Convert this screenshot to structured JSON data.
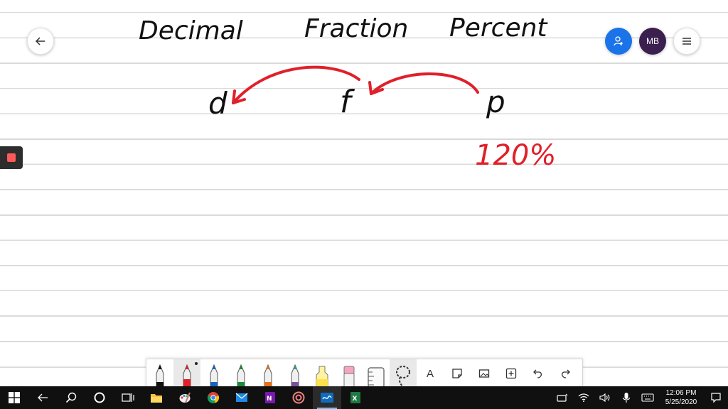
{
  "header": {
    "avatar_initials": "MB"
  },
  "handwriting": {
    "word_decimal": "Decimal",
    "word_fraction": "Fraction",
    "word_percent": "Percent",
    "letter_d": "d",
    "letter_f": "f",
    "letter_p": "p",
    "value_percent": "120%"
  },
  "colors": {
    "ink_black": "#111111",
    "ink_red": "#e0202a",
    "share_blue": "#1a73e8",
    "avatar_purple": "#3b1f4f",
    "taskbar": "#101010"
  },
  "toolbar": {
    "tools": [
      "pen-black",
      "pen-red",
      "pen-blue",
      "pen-green",
      "pen-orange",
      "pen-teal",
      "highlighter-yellow",
      "eraser",
      "ruler",
      "lasso"
    ],
    "actions": [
      "text-icon",
      "sticky-note-icon",
      "image-icon",
      "add-icon",
      "undo-icon",
      "redo-icon"
    ],
    "text_tool_label": "A"
  },
  "taskbar": {
    "time": "12:06 PM",
    "date": "5/25/2020"
  }
}
